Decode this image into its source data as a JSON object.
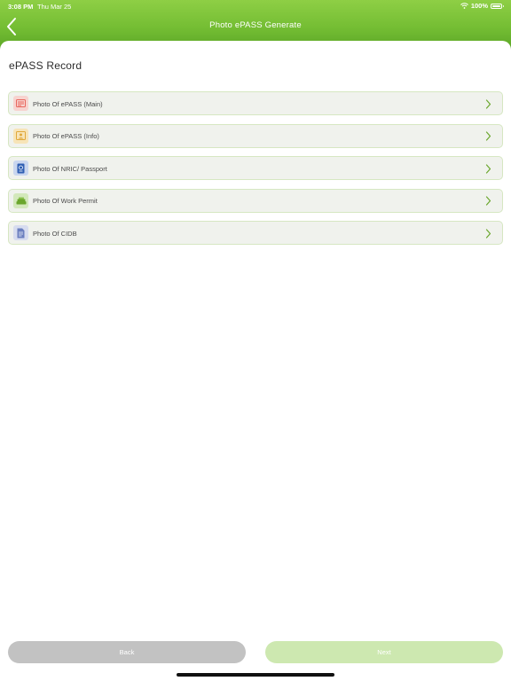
{
  "status_bar": {
    "time": "3:08 PM",
    "date": "Thu Mar 25",
    "battery": "100%"
  },
  "nav": {
    "title": "Photo ePASS Generate",
    "back_icon": "chevron-left-icon"
  },
  "section_title": "ePASS Record",
  "items": [
    {
      "label": "Photo Of ePASS (Main)",
      "icon": "epass-main-icon",
      "icon_color": "#e8675d",
      "icon_bg": "#f7d3cf"
    },
    {
      "label": "Photo Of ePASS (Info)",
      "icon": "epass-info-icon",
      "icon_color": "#e0a83a",
      "icon_bg": "#f7e4b8"
    },
    {
      "label": "Photo Of NRIC/ Passport",
      "icon": "passport-icon",
      "icon_color": "#2f5fb3",
      "icon_bg": "#c9d6ef"
    },
    {
      "label": "Photo Of Work Permit",
      "icon": "work-permit-icon",
      "icon_color": "#6aa62c",
      "icon_bg": "#d3e8bb"
    },
    {
      "label": "Photo Of CIDB",
      "icon": "cidb-document-icon",
      "icon_color": "#6b7fbf",
      "icon_bg": "#d7dcef"
    }
  ],
  "buttons": {
    "back": "Back",
    "next": "Next"
  },
  "colors": {
    "accent": "#74bd33",
    "row_bg": "#f0f2ed",
    "row_border": "#d6e7c2",
    "chevron": "#6aa62c",
    "back_button": "#c2c2c2",
    "next_button": "#cde8b0"
  }
}
